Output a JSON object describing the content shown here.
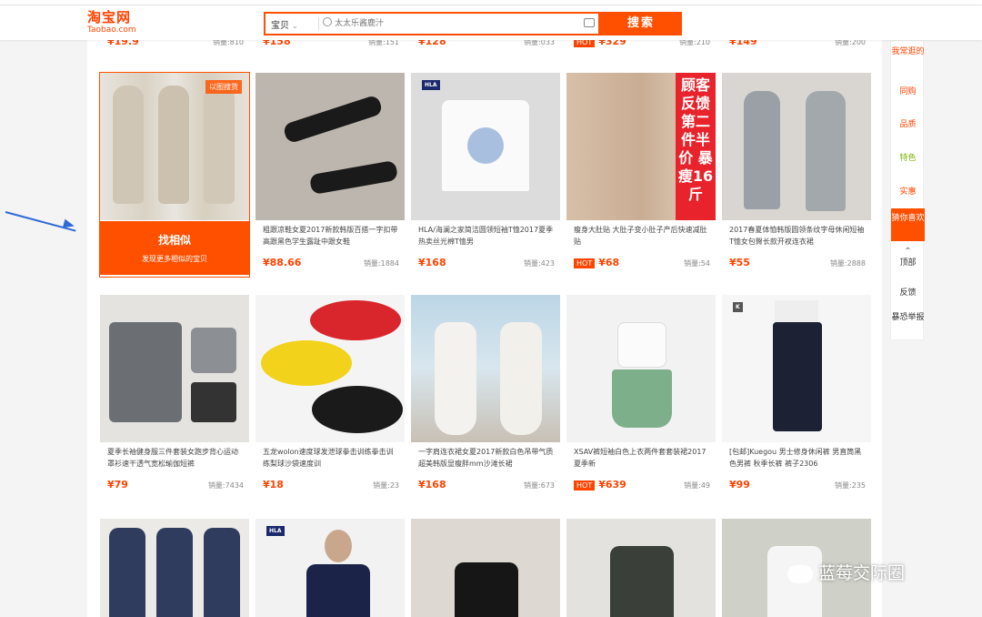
{
  "header": {
    "logo_cn": "淘宝网",
    "logo_en": "Taobao.com",
    "search_scope": "宝贝",
    "search_placeholder": "太太乐酱鹿汁",
    "search_button": "搜索"
  },
  "top_partial_row": [
    {
      "price": "¥19.9",
      "sales": "销量:810"
    },
    {
      "price": "¥158",
      "sales": "销量:151"
    },
    {
      "price": "¥128",
      "sales": "销量:033"
    },
    {
      "hot": "HOT",
      "price": "¥329",
      "sales": "销量:210"
    },
    {
      "price": "¥149",
      "sales": "销量:200"
    }
  ],
  "hover_panel": {
    "image_search_badge": "以图搜货",
    "title": "找相似",
    "subtitle": "发现更多相似的宝贝"
  },
  "row1": [
    {
      "desc": "",
      "price": "",
      "sales": ""
    },
    {
      "desc": "粗跟凉鞋女夏2017新款韩版百搭一字扣带高跟黑色学生露趾中跟女鞋",
      "price": "¥88.66",
      "sales": "销量:1884"
    },
    {
      "brand": "HLA",
      "desc": "HLA/海澜之家简洁圆领短袖T恤2017夏季热卖丝光棉T恤男",
      "price": "¥168",
      "sales": "销量:423"
    },
    {
      "promo": "顾客反馈第二件半价 暴瘦16斤",
      "desc": "瘦身大肚贴 大肚子变小肚子产后快速减肚贴",
      "hot": "HOT",
      "price": "¥68",
      "sales": "销量:54"
    },
    {
      "desc": "2017春夏体恤韩版圆领条纹字母休闲短袖T恤女包臀长款开衩连衣裙",
      "price": "¥55",
      "sales": "销量:2888"
    }
  ],
  "row2": [
    {
      "desc": "夏季长袖健身服三件套装女跑步背心运动罩衫速干透气宽松瑜伽短裤",
      "price": "¥79",
      "sales": "销量:7434"
    },
    {
      "desc": "五龙wolon速度球发泄球拳击训练拳击训练梨球沙袋速度训",
      "price": "¥18",
      "sales": "销量:23"
    },
    {
      "desc": "一字肩连衣裙女夏2017新款白色吊带气质超美韩版显瘦胖mm沙滩长裙",
      "price": "¥168",
      "sales": "销量:673"
    },
    {
      "desc": "XSAV裤短袖白色上衣两件套套装裙2017夏季新",
      "hot": "HOT",
      "price": "¥639",
      "sales": "销量:49"
    },
    {
      "brand": "K",
      "desc": "[包邮]Kuegou 男士修身休闲裤 男直筒黑色男裤 秋季长裤 裤子2306",
      "price": "¥99",
      "sales": "销量:235"
    }
  ],
  "row3_brand": "HLA",
  "sidebar": {
    "items": [
      "我常逛的",
      "同购",
      "品质",
      "特色",
      "实惠",
      "猜你喜欢",
      "顶部",
      "反馈",
      "暴恐举报"
    ]
  },
  "watermark": "蓝莓交际圈",
  "colors": {
    "accent": "#ff5000",
    "price": "#ff4400",
    "arrow": "#2e6ad6"
  }
}
